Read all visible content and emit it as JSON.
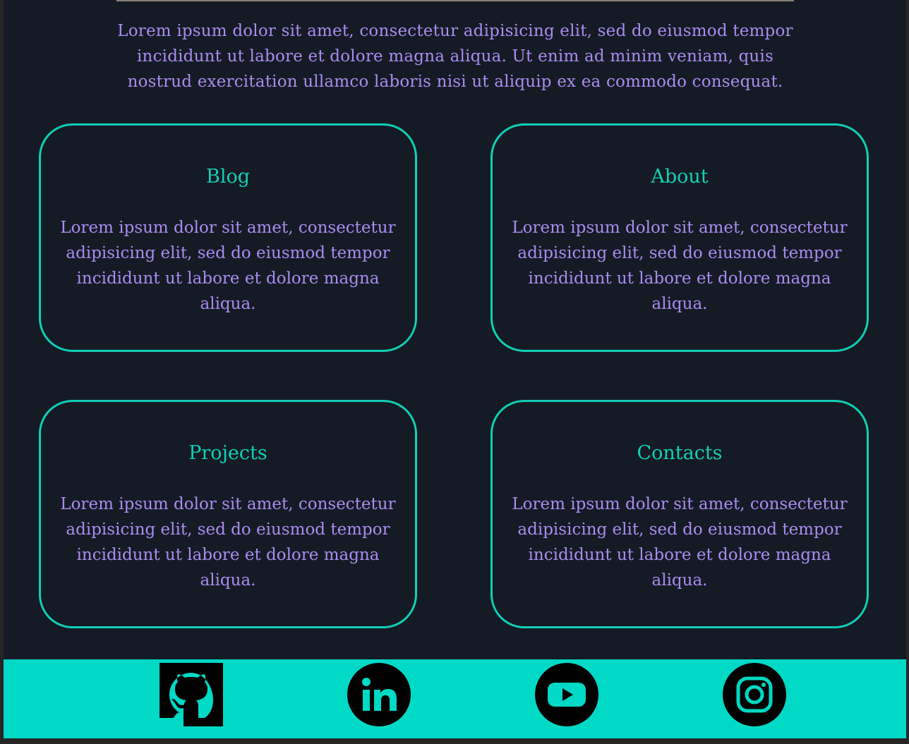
{
  "intro": {
    "text": "Lorem ipsum dolor sit amet, consectetur adipisicing elit, sed do eiusmod tempor incididunt ut labore et dolore magna aliqua. Ut enim ad minim veniam, quis nostrud exercitation ullamco laboris nisi ut aliquip ex ea commodo consequat."
  },
  "cards": [
    {
      "title": "Blog",
      "text": "Lorem ipsum dolor sit amet, consectetur adipisicing elit, sed do eiusmod tempor incididunt ut labore et dolore magna aliqua."
    },
    {
      "title": "About",
      "text": "Lorem ipsum dolor sit amet, consectetur adipisicing elit, sed do eiusmod tempor incididunt ut labore et dolore magna aliqua."
    },
    {
      "title": "Projects",
      "text": "Lorem ipsum dolor sit amet, consectetur adipisicing elit, sed do eiusmod tempor incididunt ut labore et dolore magna aliqua."
    },
    {
      "title": "Contacts",
      "text": "Lorem ipsum dolor sit amet, consectetur adipisicing elit, sed do eiusmod tempor incididunt ut labore et dolore magna aliqua."
    }
  ],
  "footer": {
    "social_icons": [
      "github-icon",
      "linkedin-icon",
      "youtube-icon",
      "instagram-icon"
    ]
  },
  "colors": {
    "background": "#151b24",
    "accent": "#10cfb8",
    "text": "#a98cf2",
    "footer": "#00d9c5"
  }
}
